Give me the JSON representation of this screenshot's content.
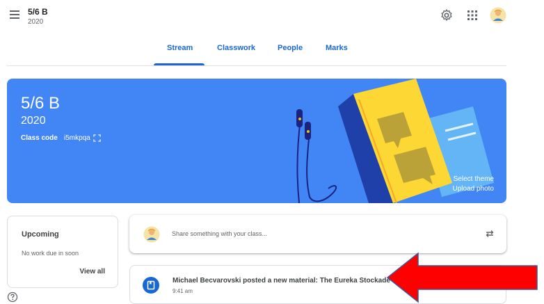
{
  "header": {
    "class_name": "5/6 B",
    "class_year": "2020",
    "icons": [
      "menu-icon",
      "settings-icon",
      "apps-grid-icon",
      "avatar"
    ]
  },
  "tabs": [
    {
      "label": "Stream",
      "active": true
    },
    {
      "label": "Classwork",
      "active": false
    },
    {
      "label": "People",
      "active": false
    },
    {
      "label": "Marks",
      "active": false
    }
  ],
  "banner": {
    "title": "5/6 B",
    "year": "2020",
    "class_code_label": "Class code",
    "class_code": "i5mkpqa",
    "select_theme": "Select theme",
    "upload_photo": "Upload photo",
    "color": "#4285f4"
  },
  "upcoming": {
    "title": "Upcoming",
    "empty_text": "No work due in soon",
    "view_all": "View all"
  },
  "share": {
    "placeholder": "Share something with your class..."
  },
  "post": {
    "text": "Michael Becvarovski posted a new material: The Eureka Stockade",
    "time": "9:41 am",
    "icon": "material-icon"
  },
  "colors": {
    "accent": "#1967d2",
    "annotation_arrow": "#ff0000"
  }
}
